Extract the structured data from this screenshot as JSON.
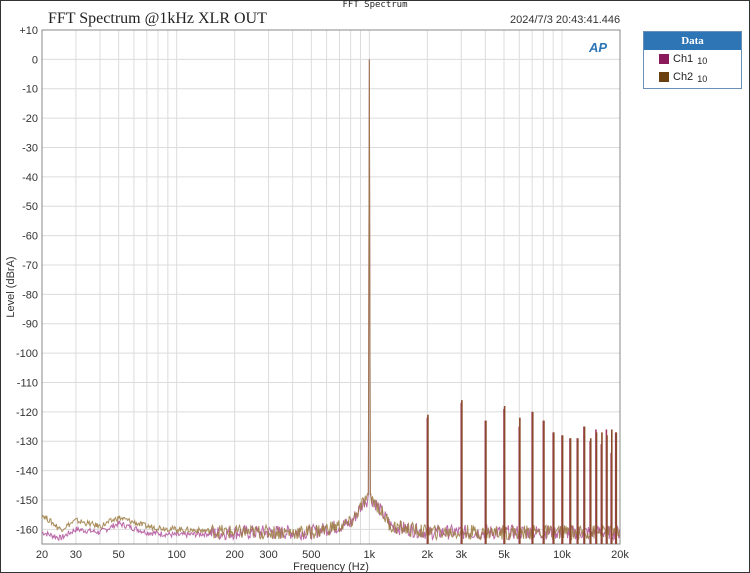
{
  "window_title": "FFT Spectrum",
  "timestamp": "2024/7/3 20:43:41.446",
  "logo": "AP",
  "legend": {
    "title": "Data",
    "items": [
      {
        "label": "Ch1",
        "count": "10",
        "color": "#8b1a5a"
      },
      {
        "label": "Ch2",
        "count": "10",
        "color": "#6b4010"
      }
    ]
  },
  "chart_data": {
    "type": "line",
    "title": "FFT Spectrum @1kHz XLR OUT",
    "xlabel": "Frequency (Hz)",
    "ylabel": "Level (dBrA)",
    "xscale": "log",
    "xlim": [
      20,
      20000
    ],
    "ylim": [
      -165,
      10
    ],
    "grid": true,
    "legend_position": "right-outside",
    "xticks": [
      {
        "v": 20,
        "l": "20"
      },
      {
        "v": 30,
        "l": "30"
      },
      {
        "v": 50,
        "l": "50"
      },
      {
        "v": 100,
        "l": "100"
      },
      {
        "v": 200,
        "l": "200"
      },
      {
        "v": 300,
        "l": "300"
      },
      {
        "v": 500,
        "l": "500"
      },
      {
        "v": 1000,
        "l": "1k"
      },
      {
        "v": 2000,
        "l": "2k"
      },
      {
        "v": 3000,
        "l": "3k"
      },
      {
        "v": 5000,
        "l": "5k"
      },
      {
        "v": 10000,
        "l": "10k"
      },
      {
        "v": 20000,
        "l": "20k"
      }
    ],
    "yticks": [
      "+10",
      "0",
      "-10",
      "-20",
      "-30",
      "-40",
      "-50",
      "-60",
      "-70",
      "-80",
      "-90",
      "-100",
      "-110",
      "-120",
      "-130",
      "-140",
      "-150",
      "-160"
    ],
    "series": [
      {
        "name": "Ch1",
        "color": "#b0509a",
        "noise": [
          [
            20,
            -161
          ],
          [
            25,
            -163
          ],
          [
            30,
            -160
          ],
          [
            40,
            -161
          ],
          [
            50,
            -158
          ],
          [
            70,
            -161
          ],
          [
            100,
            -162
          ],
          [
            200,
            -161
          ],
          [
            500,
            -161
          ],
          [
            800,
            -158
          ],
          [
            950,
            -150
          ],
          [
            1000,
            0
          ],
          [
            1050,
            -150
          ],
          [
            1300,
            -159
          ],
          [
            2000,
            -161
          ],
          [
            20000,
            -161
          ]
        ],
        "harmonics": [
          [
            2000,
            -122
          ],
          [
            3000,
            -117
          ],
          [
            4000,
            -123
          ],
          [
            5000,
            -119
          ],
          [
            6000,
            -125
          ],
          [
            7000,
            -120
          ],
          [
            8000,
            -123
          ],
          [
            9000,
            -127
          ],
          [
            10000,
            -128
          ],
          [
            11000,
            -129
          ],
          [
            12000,
            -129
          ],
          [
            13000,
            -125
          ],
          [
            14000,
            -130
          ],
          [
            15000,
            -126
          ],
          [
            16000,
            -131
          ],
          [
            17000,
            -126
          ],
          [
            18000,
            -134
          ],
          [
            19000,
            -127
          ]
        ]
      },
      {
        "name": "Ch2",
        "color": "#9a7a40",
        "noise": [
          [
            20,
            -155
          ],
          [
            25,
            -160
          ],
          [
            30,
            -157
          ],
          [
            40,
            -159
          ],
          [
            50,
            -156
          ],
          [
            70,
            -159
          ],
          [
            100,
            -160
          ],
          [
            200,
            -161
          ],
          [
            500,
            -161
          ],
          [
            800,
            -158
          ],
          [
            950,
            -150
          ],
          [
            1000,
            0
          ],
          [
            1050,
            -150
          ],
          [
            1300,
            -159
          ],
          [
            2000,
            -161
          ],
          [
            20000,
            -161
          ]
        ],
        "harmonics": [
          [
            2000,
            -121
          ],
          [
            3000,
            -116
          ],
          [
            4000,
            -123
          ],
          [
            5000,
            -118
          ],
          [
            6000,
            -122
          ],
          [
            7000,
            -120
          ],
          [
            8000,
            -123
          ],
          [
            9000,
            -127
          ],
          [
            10000,
            -128
          ],
          [
            11000,
            -129
          ],
          [
            12000,
            -129
          ],
          [
            13000,
            -125
          ],
          [
            14000,
            -129
          ],
          [
            15000,
            -127
          ],
          [
            16000,
            -127
          ],
          [
            17000,
            -128
          ],
          [
            18000,
            -126
          ],
          [
            19000,
            -127
          ]
        ]
      }
    ]
  }
}
